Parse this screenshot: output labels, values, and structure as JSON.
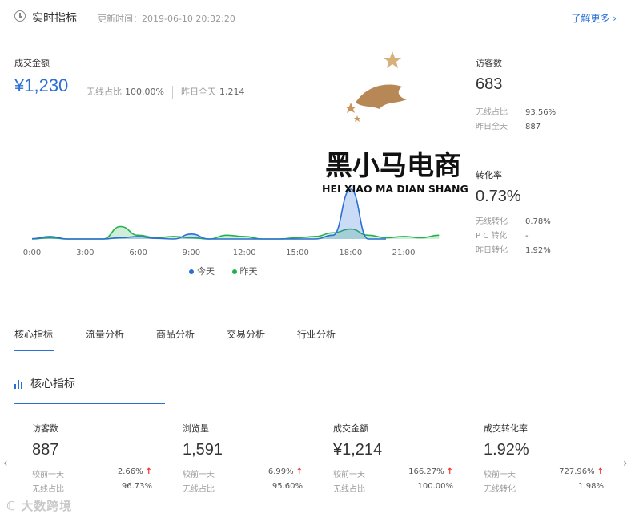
{
  "header": {
    "title": "实时指标",
    "update_time": "更新时间：2019-06-10 20:32:20",
    "learn_more": "了解更多 ›"
  },
  "gmv": {
    "label": "成交金额",
    "value": "¥1,230",
    "wireless_label": "无线占比",
    "wireless_value": "100.00%",
    "yesterday_label": "昨日全天",
    "yesterday_value": "1,214"
  },
  "visitors": {
    "label": "访客数",
    "value": "683",
    "rows": [
      {
        "k": "无线占比",
        "v": "93.56%"
      },
      {
        "k": "昨日全天",
        "v": "887"
      }
    ]
  },
  "conversion": {
    "label": "转化率",
    "value": "0.73%",
    "rows": [
      {
        "k": "无线转化",
        "v": "0.78%"
      },
      {
        "k": "P C 转化",
        "v": "-"
      },
      {
        "k": "昨日转化",
        "v": "1.92%"
      }
    ]
  },
  "chart_data": {
    "type": "area",
    "x": [
      "0:00",
      "1:00",
      "2:00",
      "3:00",
      "4:00",
      "5:00",
      "6:00",
      "7:00",
      "8:00",
      "9:00",
      "10:00",
      "11:00",
      "12:00",
      "13:00",
      "14:00",
      "15:00",
      "16:00",
      "17:00",
      "18:00",
      "19:00",
      "20:00",
      "21:00",
      "22:00",
      "23:00"
    ],
    "tick_labels": [
      "0:00",
      "3:00",
      "6:00",
      "9:00",
      "12:00",
      "15:00",
      "18:00",
      "21:00"
    ],
    "series": [
      {
        "name": "今天",
        "color": "#2b6fd6",
        "values": [
          0.2,
          2,
          0,
          0,
          0,
          1,
          2,
          0.5,
          0,
          4,
          0,
          0,
          0,
          0,
          0,
          0,
          0,
          3,
          40,
          0,
          0
        ]
      },
      {
        "name": "昨天",
        "color": "#22b14c",
        "values": [
          0,
          1,
          0,
          0,
          0,
          10,
          3,
          1,
          2,
          1,
          0,
          3,
          2,
          0,
          0,
          1,
          2,
          5,
          8,
          3,
          1,
          2,
          1,
          3
        ]
      }
    ],
    "legend_position": "bottom-center"
  },
  "logo": {
    "brand": "黑小马电商",
    "brand_en": "HEI XIAO MA DIAN SHANG"
  },
  "tabs": [
    "核心指标",
    "流量分析",
    "商品分析",
    "交易分析",
    "行业分析"
  ],
  "section": {
    "title": "核心指标"
  },
  "metrics": [
    {
      "label": "访客数",
      "value": "887",
      "cmp_label": "较前一天",
      "cmp_value": "2.66%",
      "sub_label": "无线占比",
      "sub_value": "96.73%"
    },
    {
      "label": "浏览量",
      "value": "1,591",
      "cmp_label": "较前一天",
      "cmp_value": "6.99%",
      "sub_label": "无线占比",
      "sub_value": "95.60%"
    },
    {
      "label": "成交金额",
      "value": "¥1,214",
      "cmp_label": "较前一天",
      "cmp_value": "166.27%",
      "sub_label": "无线占比",
      "sub_value": "100.00%"
    },
    {
      "label": "成交转化率",
      "value": "1.92%",
      "cmp_label": "较前一天",
      "cmp_value": "727.96%",
      "sub_label": "无线转化",
      "sub_value": "1.98%"
    }
  ],
  "arrow_up": "↑",
  "nav": {
    "left": "‹",
    "right": "›"
  },
  "watermark": "ℂ 大数跨境"
}
